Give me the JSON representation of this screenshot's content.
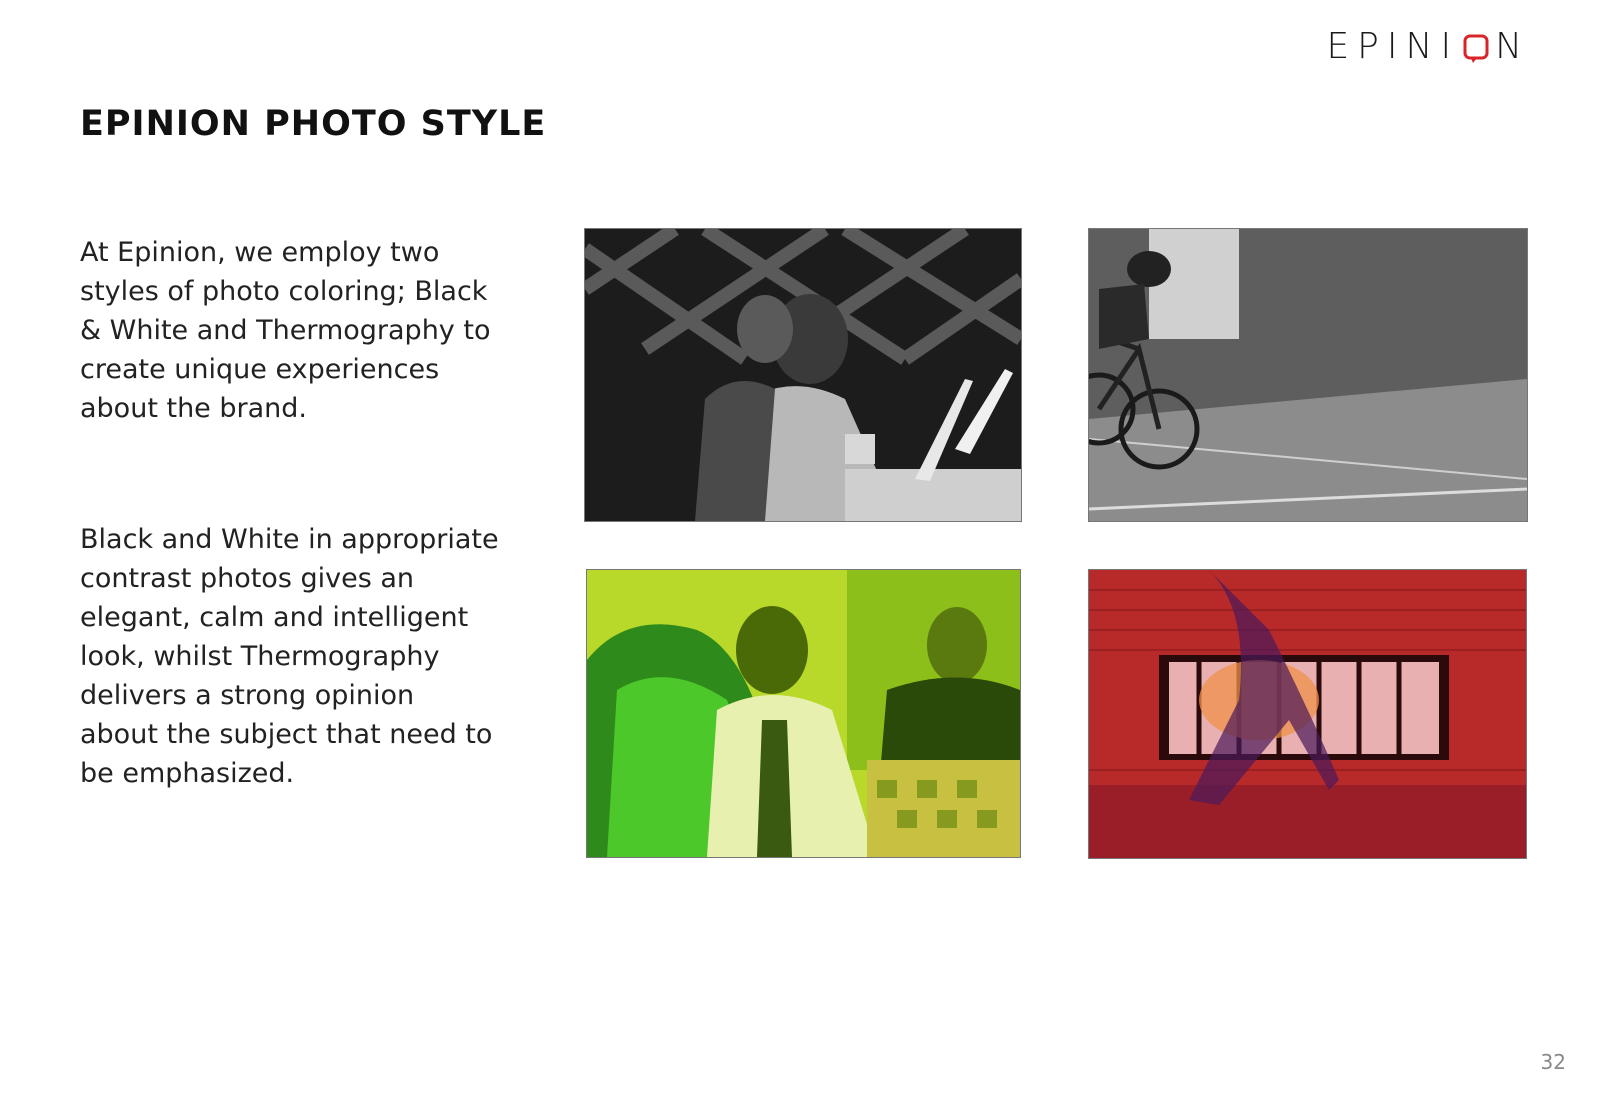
{
  "header": {
    "logo_text_left": "EPINI",
    "logo_text_right": "N",
    "logo_accent_color": "#d9252a"
  },
  "title": "EPINION PHOTO STYLE",
  "paragraphs": [
    "At Epinion, we employ two styles of photo coloring; Black & White and Thermography to create unique experiences about the brand.",
    "Black and White in appropriate contrast photos gives an elegant, calm and intelligent look, whilst Thermography delivers a strong opinion about the subject that need to be emphasized."
  ],
  "photos": [
    {
      "subject": "people-working-on-laptops",
      "style": "black-and-white"
    },
    {
      "subject": "cyclist-on-road",
      "style": "black-and-white"
    },
    {
      "subject": "men-talking-at-table",
      "style": "green-thermography"
    },
    {
      "subject": "person-walking-past-brick-wall",
      "style": "red-thermography"
    }
  ],
  "page_number": "32"
}
